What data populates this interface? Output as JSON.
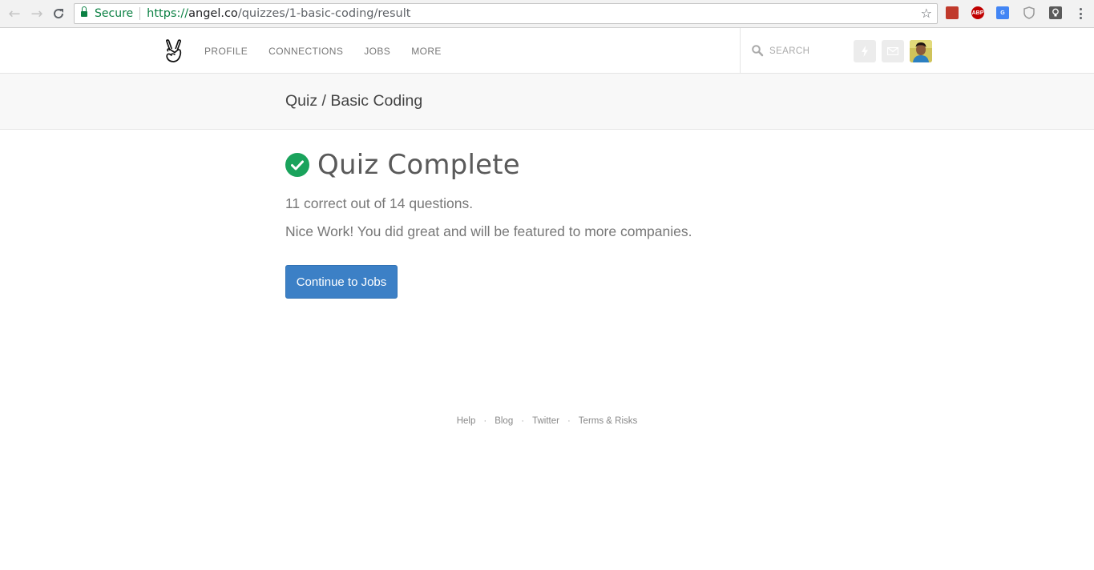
{
  "browser": {
    "secure_label": "Secure",
    "url_scheme": "https://",
    "url_host": "angel.co",
    "url_path": "/quizzes/1-basic-coding/result",
    "extensions": [
      {
        "name": "bookmark-extension-icon",
        "color": "#c0392b",
        "label": ""
      },
      {
        "name": "adblock-plus-icon",
        "color": "#c00000",
        "label": "ABP"
      },
      {
        "name": "google-translate-icon",
        "color": "#4285f4",
        "label": ""
      },
      {
        "name": "shield-extension-icon",
        "color": "#9a9a9a",
        "label": ""
      },
      {
        "name": "lightbulb-extension-icon",
        "color": "#5a5a5a",
        "label": ""
      }
    ]
  },
  "header": {
    "nav": [
      {
        "label": "PROFILE"
      },
      {
        "label": "CONNECTIONS"
      },
      {
        "label": "JOBS"
      },
      {
        "label": "MORE"
      }
    ],
    "search_placeholder": "SEARCH"
  },
  "subheader": {
    "title": "Quiz / Basic Coding"
  },
  "main": {
    "title": "Quiz Complete",
    "score_text": "11 correct out of 14 questions.",
    "message": "Nice Work! You did great and will be featured to more companies.",
    "cta_label": "Continue to Jobs"
  },
  "footer": {
    "links": [
      {
        "label": "Help"
      },
      {
        "label": "Blog"
      },
      {
        "label": "Twitter"
      },
      {
        "label": "Terms & Risks"
      }
    ]
  },
  "colors": {
    "accent": "#3c80c6",
    "success": "#1aa35c",
    "secure": "#0b8043"
  }
}
